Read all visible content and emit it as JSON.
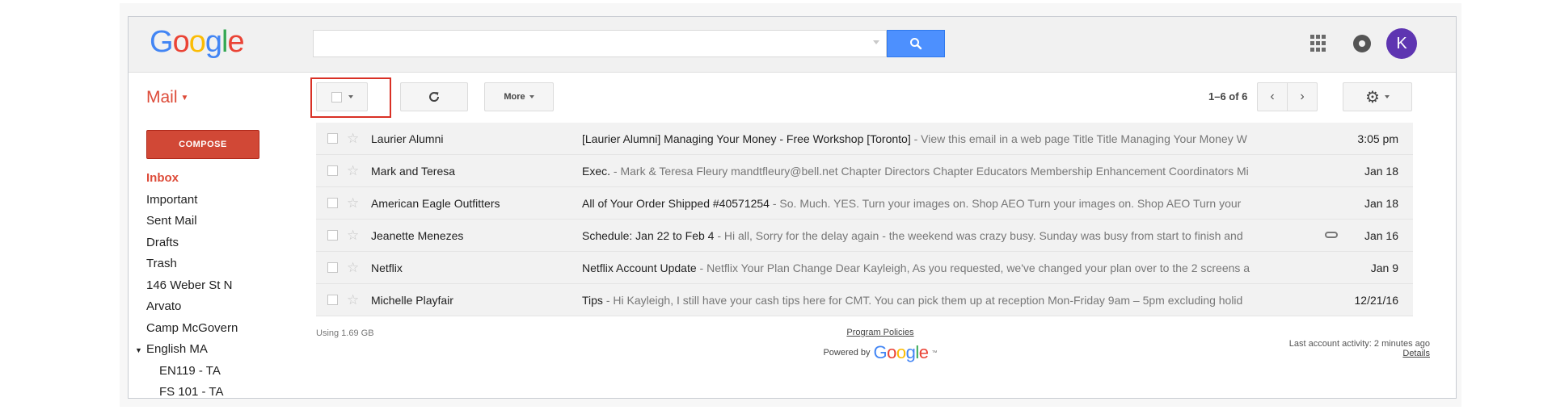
{
  "header": {
    "logo_letters": [
      {
        "ch": "G",
        "color": "#4285f4"
      },
      {
        "ch": "o",
        "color": "#ea4335"
      },
      {
        "ch": "o",
        "color": "#fbbc05"
      },
      {
        "ch": "g",
        "color": "#4285f4"
      },
      {
        "ch": "l",
        "color": "#34a853"
      },
      {
        "ch": "e",
        "color": "#ea4335"
      }
    ],
    "search": {
      "value": "",
      "placeholder": ""
    },
    "avatar_initial": "K"
  },
  "toolbar": {
    "mail_label": "Mail",
    "more_label": "More",
    "page_info": "1–6 of 6",
    "refresh_icon": "refresh-icon",
    "settings_icon": "gear-icon"
  },
  "sidebar": {
    "compose_label": "COMPOSE",
    "items": [
      {
        "label": "Inbox",
        "active": true
      },
      {
        "label": "Important"
      },
      {
        "label": "Sent Mail"
      },
      {
        "label": "Drafts"
      },
      {
        "label": "Trash"
      },
      {
        "label": "146 Weber St N"
      },
      {
        "label": "Arvato"
      },
      {
        "label": "Camp McGovern"
      },
      {
        "label": "English MA",
        "expanded": true
      },
      {
        "label": "EN119 - TA",
        "sub": true
      },
      {
        "label": "FS 101 - TA",
        "sub": true
      }
    ]
  },
  "messages": [
    {
      "sender": "Laurier Alumni",
      "subject": "[Laurier Alumni] Managing Your Money - Free Workshop [Toronto]",
      "snippet": " - View this email in a web page Title Title Managing Your Money W",
      "date": "3:05 pm"
    },
    {
      "sender": "Mark and Teresa",
      "subject": "Exec.",
      "snippet": " - Mark & Teresa Fleury mandtfleury@bell.net Chapter Directors Chapter Educators Membership Enhancement Coordinators Mi",
      "date": "Jan 18"
    },
    {
      "sender": "American Eagle Outfitters",
      "subject": "All of Your Order Shipped #40571254",
      "snippet": " - So. Much. YES. Turn your images on. Shop AEO Turn your images on. Shop AEO Turn your",
      "date": "Jan 18"
    },
    {
      "sender": "Jeanette Menezes",
      "subject": "Schedule: Jan 22 to Feb 4",
      "snippet": " - Hi all, Sorry for the delay again - the weekend was crazy busy. Sunday was busy from start to finish and",
      "date": "Jan 16",
      "attachment": true
    },
    {
      "sender": "Netflix",
      "subject": "Netflix Account Update",
      "snippet": " - Netflix Your Plan Change Dear Kayleigh, As you requested, we've changed your plan over to the 2 screens a",
      "date": "Jan 9"
    },
    {
      "sender": "Michelle Playfair",
      "subject": "Tips",
      "snippet": " - Hi Kayleigh, I still have your cash tips here for CMT. You can pick them up at reception Mon-Friday 9am – 5pm excluding holid",
      "date": "12/21/16"
    }
  ],
  "footer": {
    "usage": "Using 1.69 GB",
    "policies": "Program Policies",
    "powered_by": "Powered by",
    "activity": "Last account activity: 2 minutes ago",
    "details": "Details"
  },
  "colors": {
    "accent": "#dd4b39",
    "compose": "#d14836",
    "search_button": "#4d90fe",
    "avatar": "#5e35b1",
    "highlight_box": "#d93025"
  }
}
